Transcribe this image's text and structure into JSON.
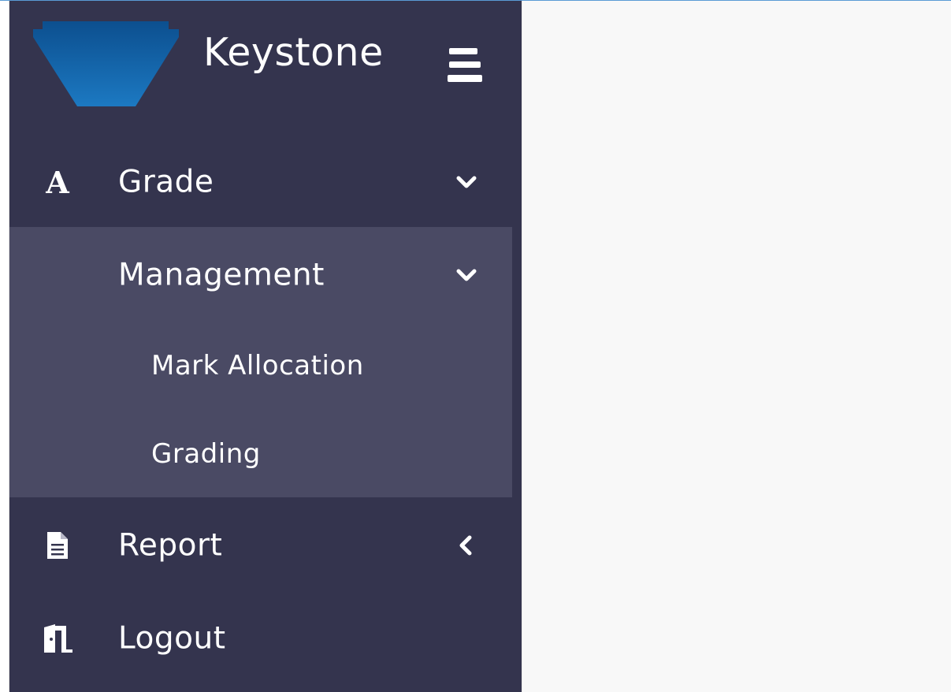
{
  "app": {
    "title": "Keystone"
  },
  "colors": {
    "sidebar_bg": "#34344e",
    "submenu_bg": "#4a4a64",
    "logo_blue": "#1a6fb5",
    "main_bg": "#f8f8f8"
  },
  "sidebar": {
    "toggle_icon": "hamburger-icon",
    "items": [
      {
        "label": "Grade",
        "icon": "letter-a-icon",
        "icon_text": "A",
        "chevron": "chevron-down-icon",
        "expanded": true,
        "children": [
          {
            "label": "Management",
            "chevron": "chevron-down-icon",
            "expanded": true,
            "children": [
              {
                "label": "Mark Allocation"
              },
              {
                "label": "Grading"
              }
            ]
          }
        ]
      },
      {
        "label": "Report",
        "icon": "document-icon",
        "chevron": "chevron-left-icon",
        "expanded": false
      },
      {
        "label": "Logout",
        "icon": "door-exit-icon"
      }
    ]
  }
}
